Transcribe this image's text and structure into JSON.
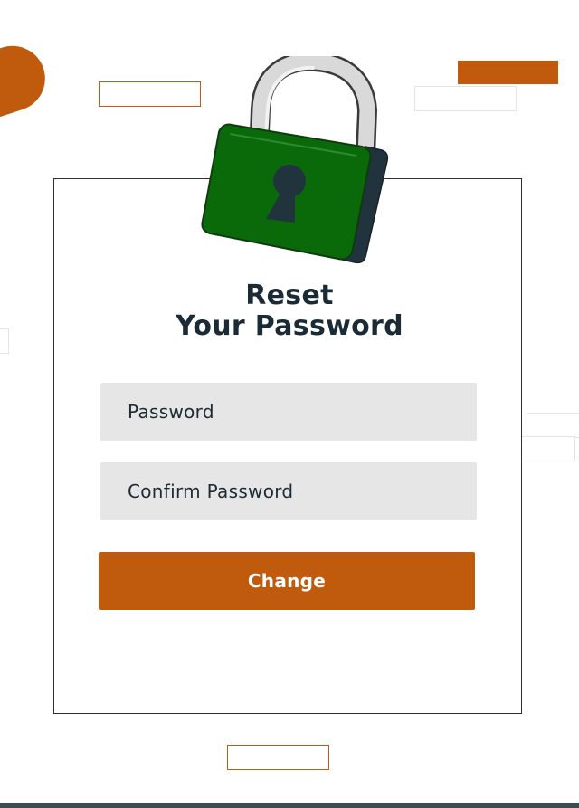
{
  "title": {
    "line1": "Reset",
    "line2": "Your Password"
  },
  "form": {
    "password_placeholder": "Password",
    "confirm_placeholder": "Confirm Password",
    "submit_label": "Change"
  },
  "illustration": {
    "icon": "padlock-icon",
    "lock_body_color": "#0a6a0a",
    "lock_side_color": "#21333d",
    "shackle_color": "#d9d9d9"
  },
  "colors": {
    "accent": "#c05a0c",
    "text": "#1a2b36",
    "field_bg": "#e6e6e6"
  }
}
